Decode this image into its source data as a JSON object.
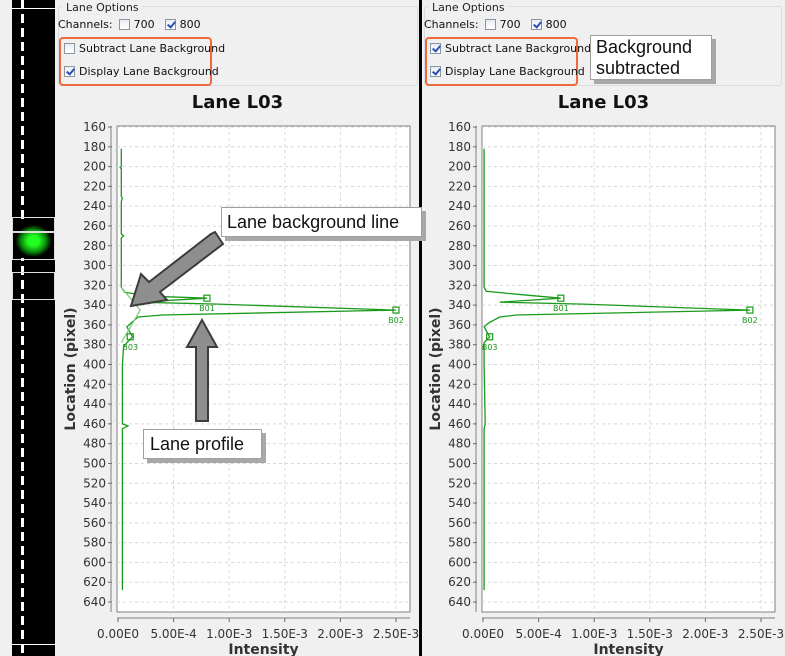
{
  "lane_strip": {
    "name": "lane-strip"
  },
  "panels": [
    {
      "id": "left",
      "lane_options": {
        "legend": "Lane Options",
        "channels_label": "Channels:",
        "channels": [
          {
            "label": "700",
            "checked": false
          },
          {
            "label": "800",
            "checked": true
          }
        ],
        "subtract_background": {
          "label": "Subtract Lane Background",
          "checked": false
        },
        "display_background": {
          "label": "Display Lane Background",
          "checked": true
        }
      },
      "chart_title": "Lane L03",
      "annotations": {
        "background_line": "Lane background line",
        "profile": "Lane profile"
      }
    },
    {
      "id": "right",
      "lane_options": {
        "legend": "Lane Options",
        "channels_label": "Channels:",
        "channels": [
          {
            "label": "700",
            "checked": false
          },
          {
            "label": "800",
            "checked": true
          }
        ],
        "subtract_background": {
          "label": "Subtract Lane Background",
          "checked": true
        },
        "display_background": {
          "label": "Display Lane Background",
          "checked": true
        }
      },
      "chart_title": "Lane L03",
      "annotations": {
        "subtracted_line1": "Background",
        "subtracted_line2": "subtracted"
      }
    }
  ],
  "colors": {
    "profile": "#1a9a1a",
    "background_line": "#7fcf7f",
    "highlight": "#f0693a"
  },
  "chart_data": [
    {
      "type": "line",
      "title": "Lane L03",
      "xlabel": "Intensity",
      "ylabel": "Location (pixel)",
      "xlim": [
        0,
        0.0026
      ],
      "ylim": [
        160,
        645
      ],
      "y_inverted": true,
      "x_ticks": [
        "0.00E0",
        "5.00E-4",
        "1.00E-3",
        "1.50E-3",
        "2.00E-3",
        "2.50E-3"
      ],
      "x_tick_values": [
        0,
        0.0005,
        0.001,
        0.0015,
        0.002,
        0.0025
      ],
      "y_ticks": [
        160,
        180,
        200,
        220,
        240,
        260,
        280,
        300,
        320,
        340,
        360,
        380,
        400,
        420,
        440,
        460,
        480,
        500,
        520,
        540,
        560,
        580,
        600,
        620,
        640
      ],
      "grid": true,
      "series": [
        {
          "name": "Lane profile",
          "points": [
            [
              3e-05,
              182
            ],
            [
              3e-05,
              200
            ],
            [
              2e-05,
              201
            ],
            [
              3e-05,
              202
            ],
            [
              3e-05,
              230
            ],
            [
              4e-05,
              232
            ],
            [
              3e-05,
              235
            ],
            [
              3e-05,
              268
            ],
            [
              5e-05,
              270
            ],
            [
              3e-05,
              272
            ],
            [
              3e-05,
              322
            ],
            [
              6e-05,
              327
            ],
            [
              0.0003,
              331
            ],
            [
              0.0008,
              333
            ],
            [
              0.00018,
              337
            ],
            [
              0.0009,
              339
            ],
            [
              0.0025,
              345
            ],
            [
              0.0004,
              350
            ],
            [
              0.00018,
              352
            ],
            [
              0.00012,
              358
            ],
            [
              8e-05,
              362
            ],
            [
              0.00013,
              372
            ],
            [
              8e-05,
              378
            ],
            [
              5e-05,
              382
            ],
            [
              4e-05,
              400
            ],
            [
              4e-05,
              460
            ],
            [
              9e-05,
              462
            ],
            [
              4e-05,
              465
            ],
            [
              4e-05,
              600
            ],
            [
              4e-05,
              628
            ]
          ]
        },
        {
          "name": "Lane background",
          "points": [
            [
              3e-05,
              322
            ],
            [
              0.0002,
              345
            ],
            [
              3e-05,
              378
            ]
          ]
        }
      ],
      "bands": [
        {
          "label": "B01",
          "intensity": 0.0008,
          "location": 333
        },
        {
          "label": "B02",
          "intensity": 0.0025,
          "location": 345
        },
        {
          "label": "B03",
          "intensity": 0.00011,
          "location": 372
        }
      ]
    },
    {
      "type": "line",
      "title": "Lane L03",
      "xlabel": "Intensity",
      "ylabel": "Location (pixel)",
      "xlim": [
        0,
        0.0026
      ],
      "ylim": [
        160,
        645
      ],
      "y_inverted": true,
      "x_ticks": [
        "0.00E0",
        "5.00E-4",
        "1.00E-3",
        "1.50E-3",
        "2.00E-3",
        "2.50E-3"
      ],
      "x_tick_values": [
        0,
        0.0005,
        0.001,
        0.0015,
        0.002,
        0.0025
      ],
      "y_ticks": [
        160,
        180,
        200,
        220,
        240,
        260,
        280,
        300,
        320,
        340,
        360,
        380,
        400,
        420,
        440,
        460,
        480,
        500,
        520,
        540,
        560,
        580,
        600,
        620,
        640
      ],
      "grid": true,
      "series": [
        {
          "name": "Lane profile (background subtracted)",
          "points": [
            [
              1e-05,
              182
            ],
            [
              1e-05,
              322
            ],
            [
              3e-05,
              326
            ],
            [
              0.0003,
              329
            ],
            [
              0.0007,
              333
            ],
            [
              0.00015,
              337
            ],
            [
              0.0009,
              339
            ],
            [
              0.0024,
              345
            ],
            [
              0.0003,
              350
            ],
            [
              0.00015,
              352
            ],
            [
              5e-05,
              358
            ],
            [
              1e-05,
              362
            ],
            [
              6e-05,
              372
            ],
            [
              1e-05,
              378
            ],
            [
              1e-05,
              400
            ],
            [
              2e-05,
              460
            ],
            [
              1e-05,
              465
            ],
            [
              1e-05,
              628
            ]
          ]
        }
      ],
      "bands": [
        {
          "label": "B01",
          "intensity": 0.0007,
          "location": 333
        },
        {
          "label": "B02",
          "intensity": 0.0024,
          "location": 345
        },
        {
          "label": "B03",
          "intensity": 6e-05,
          "location": 372
        }
      ]
    }
  ]
}
